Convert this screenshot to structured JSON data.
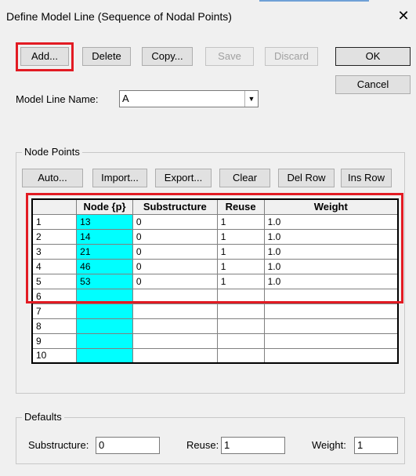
{
  "window": {
    "title": "Define Model Line (Sequence of Nodal Points)",
    "close_glyph": "✕"
  },
  "toolbar": {
    "add": "Add...",
    "delete": "Delete",
    "copy": "Copy...",
    "save": "Save",
    "discard": "Discard",
    "ok": "OK",
    "cancel": "Cancel"
  },
  "model_line": {
    "label": "Model Line Name:",
    "value": "A",
    "arrow": "▼"
  },
  "node_points": {
    "legend": "Node Points",
    "buttons": {
      "auto": "Auto...",
      "import": "Import...",
      "export": "Export...",
      "clear": "Clear",
      "del_row": "Del Row",
      "ins_row": "Ins Row"
    },
    "columns": [
      "",
      "Node {p}",
      "Substructure",
      "Reuse",
      "Weight"
    ],
    "rows": [
      [
        "1",
        "13",
        "0",
        "1",
        "1.0"
      ],
      [
        "2",
        "14",
        "0",
        "1",
        "1.0"
      ],
      [
        "3",
        "21",
        "0",
        "1",
        "1.0"
      ],
      [
        "4",
        "46",
        "0",
        "1",
        "1.0"
      ],
      [
        "5",
        "53",
        "0",
        "1",
        "1.0"
      ],
      [
        "6",
        "",
        "",
        "",
        ""
      ],
      [
        "7",
        "",
        "",
        "",
        ""
      ],
      [
        "8",
        "",
        "",
        "",
        ""
      ],
      [
        "9",
        "",
        "",
        "",
        ""
      ],
      [
        "10",
        "",
        "",
        "",
        ""
      ]
    ]
  },
  "defaults": {
    "legend": "Defaults",
    "substructure_label": "Substructure:",
    "substructure_value": "0",
    "reuse_label": "Reuse:",
    "reuse_value": "1",
    "weight_label": "Weight:",
    "weight_value": "1"
  },
  "colors": {
    "highlight": "#e21b23",
    "node_cell": "#00ffff"
  }
}
